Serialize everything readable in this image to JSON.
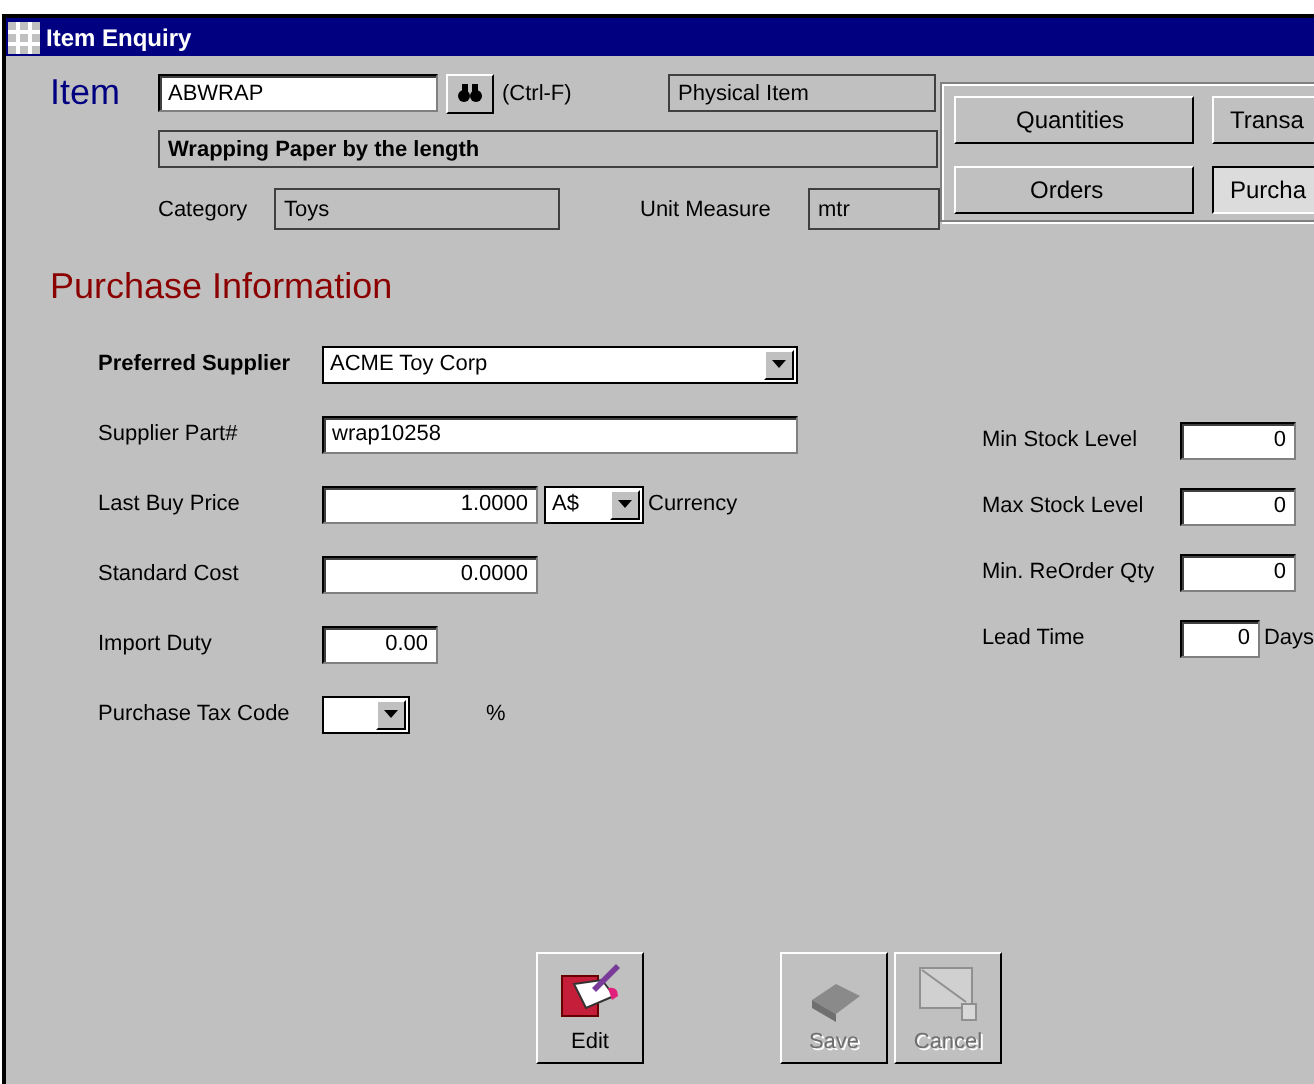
{
  "window": {
    "title": "Item Enquiry"
  },
  "item": {
    "label": "Item",
    "code": "ABWRAP",
    "shortcut": "(Ctrl-F)",
    "type": "Physical Item",
    "description": "Wrapping Paper by the length",
    "category_label": "Category",
    "category": "Toys",
    "unit_label": "Unit Measure",
    "unit": "mtr"
  },
  "views": [
    {
      "label": "Quantities",
      "selected": false
    },
    {
      "label": "Transa",
      "selected": false
    },
    {
      "label": "Orders",
      "selected": false
    },
    {
      "label": "Purcha",
      "selected": true
    }
  ],
  "section_title": "Purchase Information",
  "left_fields": [
    {
      "kind": "select",
      "label": "Preferred Supplier",
      "value": "ACME Toy Corp"
    },
    {
      "kind": "text",
      "label": "Supplier Part#",
      "value": "wrap10258"
    },
    {
      "kind": "currency",
      "label": "Last Buy Price",
      "value": "1.0000",
      "currency": "A$",
      "suffix": "Currency"
    },
    {
      "kind": "number",
      "label": "Standard Cost",
      "value": "0.0000"
    },
    {
      "kind": "short",
      "label": "Import Duty",
      "value": "0.00"
    },
    {
      "kind": "taxselect",
      "label": "Purchase Tax Code",
      "suffix": "%"
    }
  ],
  "right_fields": [
    {
      "label": "Min Stock Level",
      "value": "0"
    },
    {
      "label": "Max Stock Level",
      "value": "0"
    },
    {
      "label": "Min. ReOrder Qty",
      "value": "0"
    },
    {
      "label": "Lead Time",
      "value": "0",
      "suffix": "Days"
    }
  ],
  "actions": [
    {
      "kind": "edit",
      "label": "Edit",
      "disabled": false
    },
    {
      "kind": "save",
      "label": "Save",
      "disabled": true
    },
    {
      "kind": "cancel",
      "label": "Cancel",
      "disabled": true
    }
  ]
}
